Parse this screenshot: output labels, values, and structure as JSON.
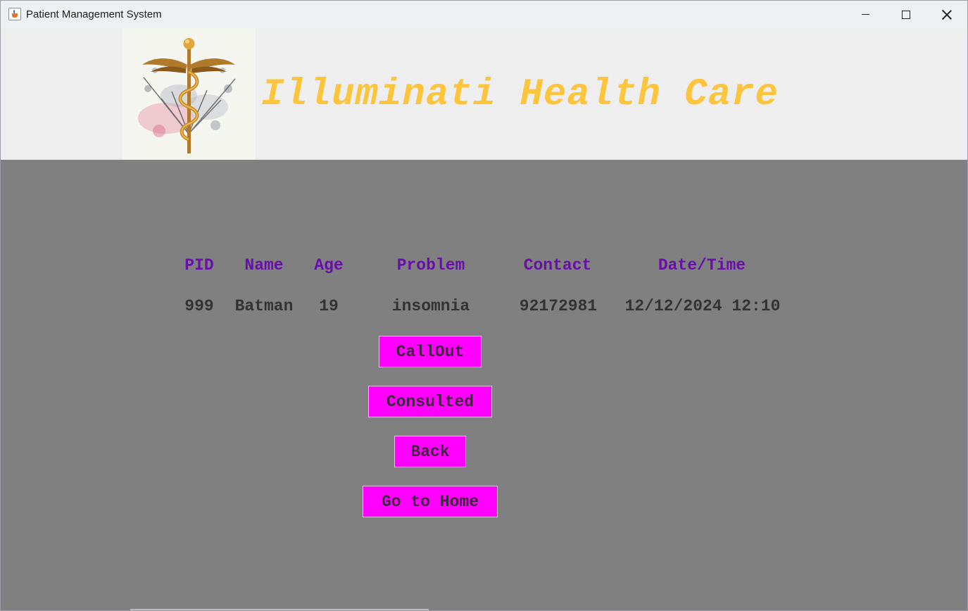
{
  "window": {
    "title": "Patient Management System",
    "icon": "java-cup-icon"
  },
  "header": {
    "brand": "Illuminati Health Care",
    "logo": "caduceus-logo",
    "brand_color": "#fdc53c"
  },
  "table": {
    "columns": [
      "PID",
      "Name",
      "Age",
      "Problem",
      "Contact",
      "Date/Time"
    ],
    "row": [
      "999",
      "Batman",
      "19",
      "insomnia",
      "92172981",
      "12/12/2024 12:10"
    ],
    "header_color": "#6a0dad"
  },
  "actions": {
    "callout": "CallOut",
    "consulted": "Consulted",
    "back": "Back",
    "home": "Go to Home",
    "button_color": "#ff00ff"
  }
}
